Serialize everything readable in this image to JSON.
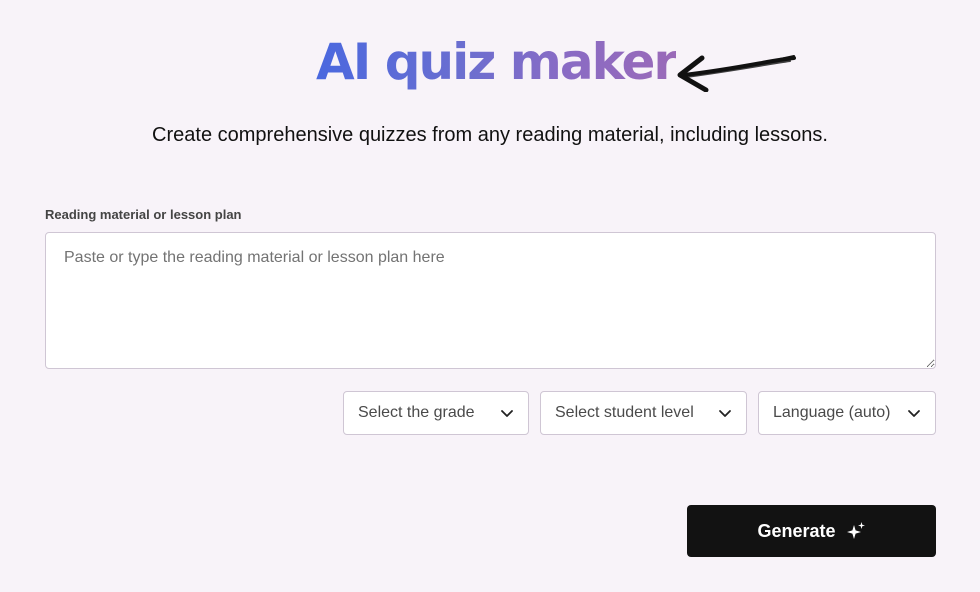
{
  "header": {
    "title": "AI quiz maker",
    "subtitle": "Create comprehensive quizzes from any reading material, including lessons.",
    "title_gradient": [
      "#4a68df",
      "#9a6ab8"
    ],
    "decoration": "arrow-icon"
  },
  "form": {
    "material": {
      "label": "Reading material or lesson plan",
      "placeholder": "Paste or type the reading material or lesson plan here",
      "value": ""
    },
    "selects": {
      "grade": {
        "selected": "Select the grade",
        "icon": "chevron-down-icon"
      },
      "level": {
        "selected": "Select student level",
        "icon": "chevron-down-icon"
      },
      "language": {
        "selected": "Language (auto)",
        "icon": "chevron-down-icon"
      }
    },
    "generate": {
      "label": "Generate",
      "icon": "sparkle-icon",
      "background": "#121212"
    }
  },
  "colors": {
    "page_background": "#f8f3f9",
    "border": "#cfc6d4"
  }
}
